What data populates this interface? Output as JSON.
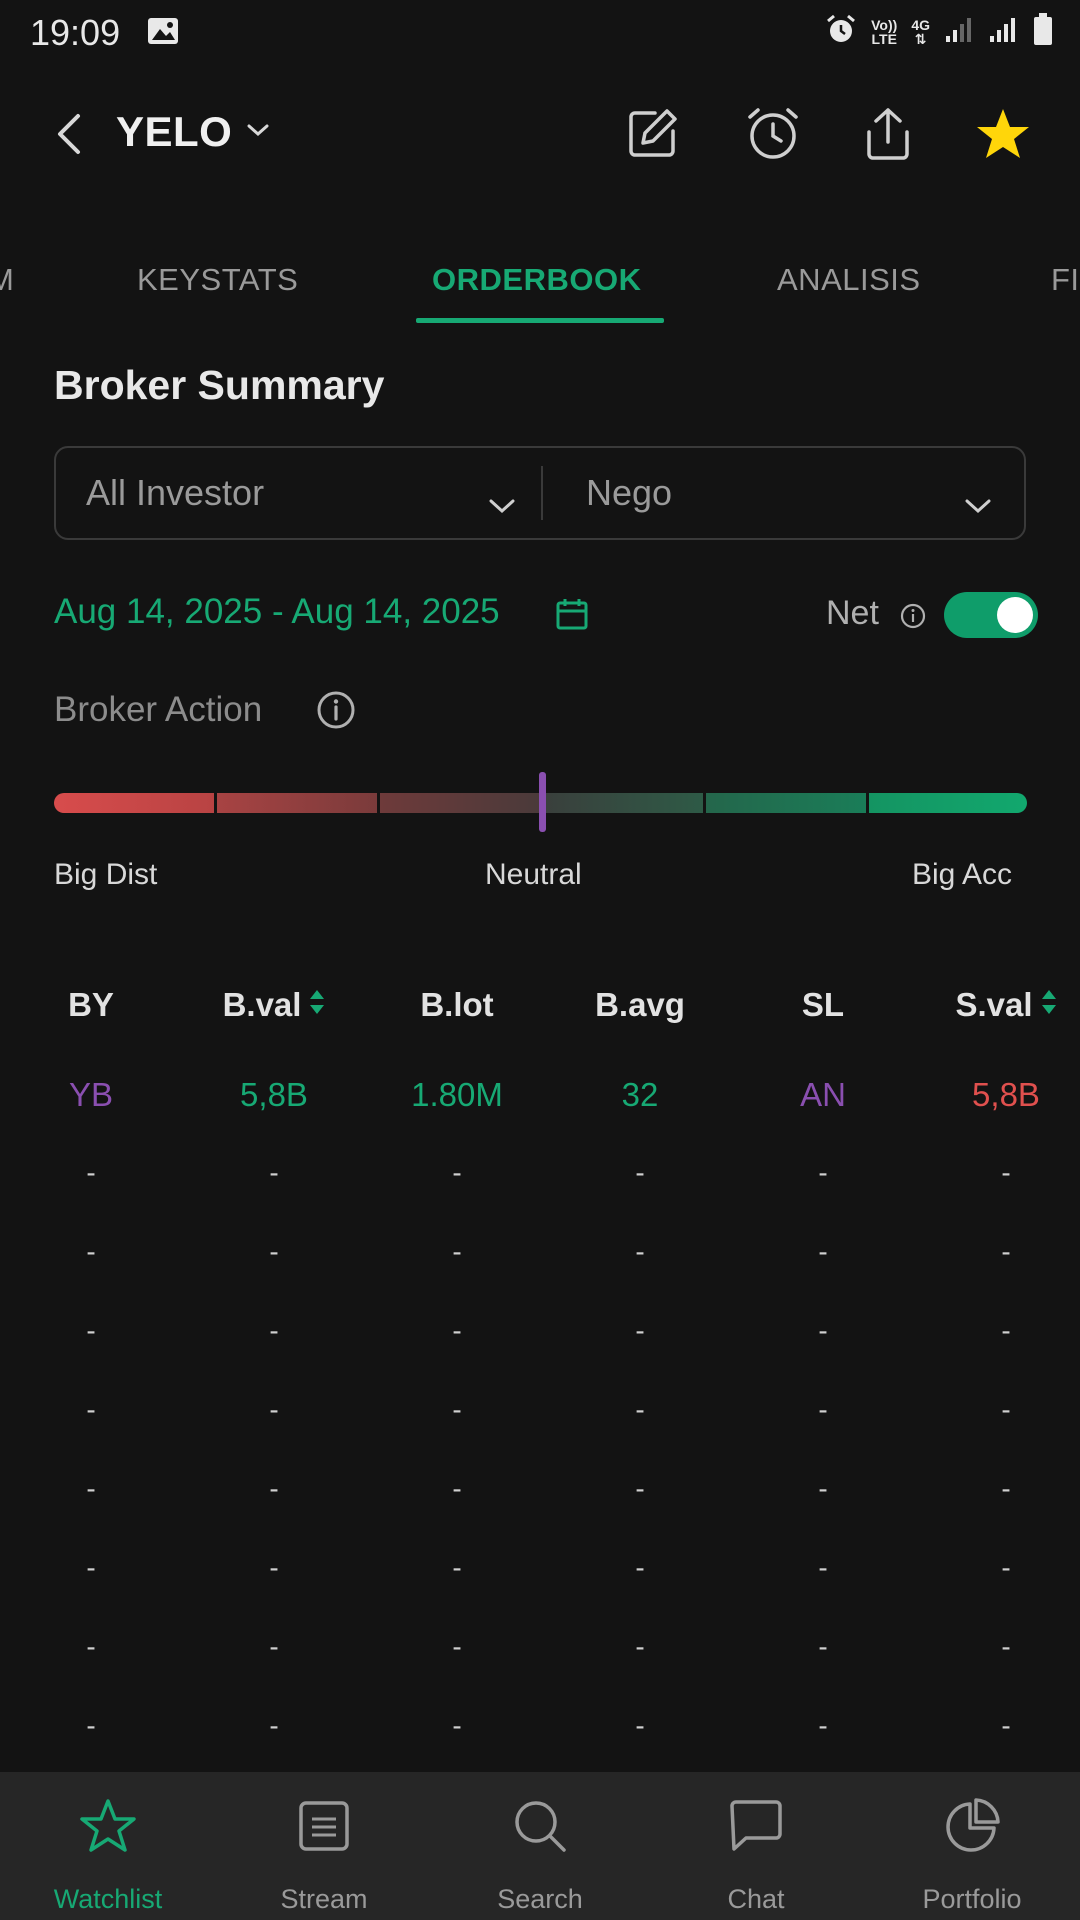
{
  "status_bar": {
    "time": "19:09",
    "volte": "Vo))",
    "lte": "LTE",
    "network": "4G"
  },
  "header": {
    "ticker": "YELO"
  },
  "tabs": [
    {
      "label": "M"
    },
    {
      "label": "KEYSTATS"
    },
    {
      "label": "ORDERBOOK"
    },
    {
      "label": "ANALISIS"
    },
    {
      "label": "FI"
    }
  ],
  "broker_summary": {
    "title": "Broker Summary",
    "investor_filter": "All Investor",
    "market_filter": "Nego",
    "date_range": "Aug 14, 2025 - Aug 14, 2025",
    "net_label": "Net",
    "net_enabled": true,
    "broker_action_label": "Broker Action",
    "gauge": {
      "left_label": "Big Dist",
      "center_label": "Neutral",
      "right_label": "Big Acc",
      "level": 0.5
    }
  },
  "table": {
    "columns": [
      "BY",
      "B.val",
      "B.lot",
      "B.avg",
      "SL",
      "S.val"
    ],
    "rows": [
      [
        "YB",
        "5,8B",
        "1.80M",
        "32",
        "AN",
        "5,8B"
      ]
    ],
    "empty_placeholder": "-"
  },
  "colors": {
    "accent": "#17a974",
    "buy": "#17a974",
    "sell": "#e0504e",
    "broker": "#8a4fb0",
    "star": "#ffd60a"
  },
  "bottom_nav": [
    {
      "label": "Watchlist",
      "icon": "star-icon",
      "active": true
    },
    {
      "label": "Stream",
      "icon": "stream-icon"
    },
    {
      "label": "Search",
      "icon": "search-icon"
    },
    {
      "label": "Chat",
      "icon": "chat-icon"
    },
    {
      "label": "Portfolio",
      "icon": "pie-chart-icon"
    }
  ]
}
